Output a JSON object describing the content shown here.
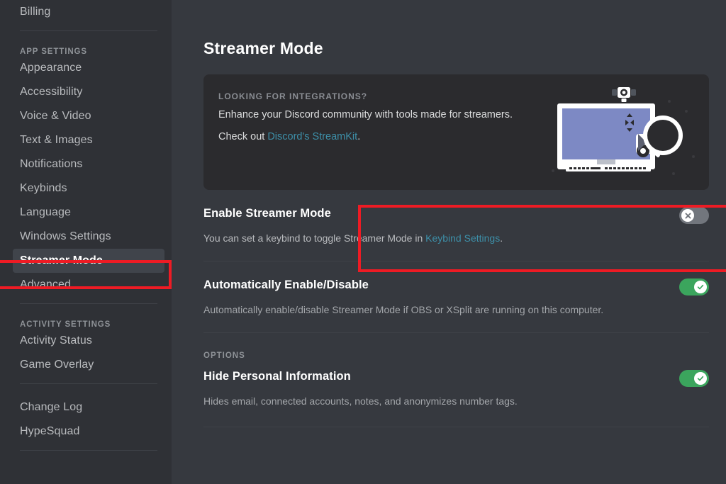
{
  "sidebar": {
    "top_items": [
      {
        "label": "Billing",
        "active": false
      }
    ],
    "app_settings_label": "APP SETTINGS",
    "app_items": [
      {
        "label": "Appearance",
        "active": false
      },
      {
        "label": "Accessibility",
        "active": false
      },
      {
        "label": "Voice & Video",
        "active": false
      },
      {
        "label": "Text & Images",
        "active": false
      },
      {
        "label": "Notifications",
        "active": false
      },
      {
        "label": "Keybinds",
        "active": false
      },
      {
        "label": "Language",
        "active": false
      },
      {
        "label": "Windows Settings",
        "active": false
      },
      {
        "label": "Streamer Mode",
        "active": true
      },
      {
        "label": "Advanced",
        "active": false
      }
    ],
    "activity_settings_label": "ACTIVITY SETTINGS",
    "activity_items": [
      {
        "label": "Activity Status",
        "active": false
      },
      {
        "label": "Game Overlay",
        "active": false
      }
    ],
    "misc_items": [
      {
        "label": "Change Log",
        "active": false
      },
      {
        "label": "HypeSquad",
        "active": false
      }
    ]
  },
  "main": {
    "page_title": "Streamer Mode",
    "promo": {
      "eyebrow": "LOOKING FOR INTEGRATIONS?",
      "line1": "Enhance your Discord community with tools made for streamers.",
      "line2_prefix": "Check out ",
      "line2_link": "Discord's StreamKit",
      "line2_suffix": "."
    },
    "settings": [
      {
        "title": "Enable Streamer Mode",
        "desc_prefix": "You can set a keybind to toggle Streamer Mode in ",
        "desc_link": "Keybind Settings",
        "desc_suffix": ".",
        "toggle_state": "off"
      },
      {
        "title": "Automatically Enable/Disable",
        "desc": "Automatically enable/disable Streamer Mode if OBS or XSplit are running on this computer.",
        "toggle_state": "on"
      }
    ],
    "options_label": "OPTIONS",
    "options": [
      {
        "title": "Hide Personal Information",
        "desc": "Hides email, connected accounts, notes, and anonymizes number tags.",
        "toggle_state": "on"
      }
    ]
  },
  "colors": {
    "sidebar_bg": "#2f3136",
    "main_bg": "#36393f",
    "card_bg": "#2b2b2e",
    "link": "#3d8fa8",
    "toggle_on": "#3ba55d",
    "toggle_off": "#72767d",
    "annotation": "#ee1b24",
    "active_item_bg": "#40444b"
  },
  "annotations": {
    "sidebar_box_target": "Streamer Mode",
    "main_box_target": "Enable Streamer Mode"
  }
}
